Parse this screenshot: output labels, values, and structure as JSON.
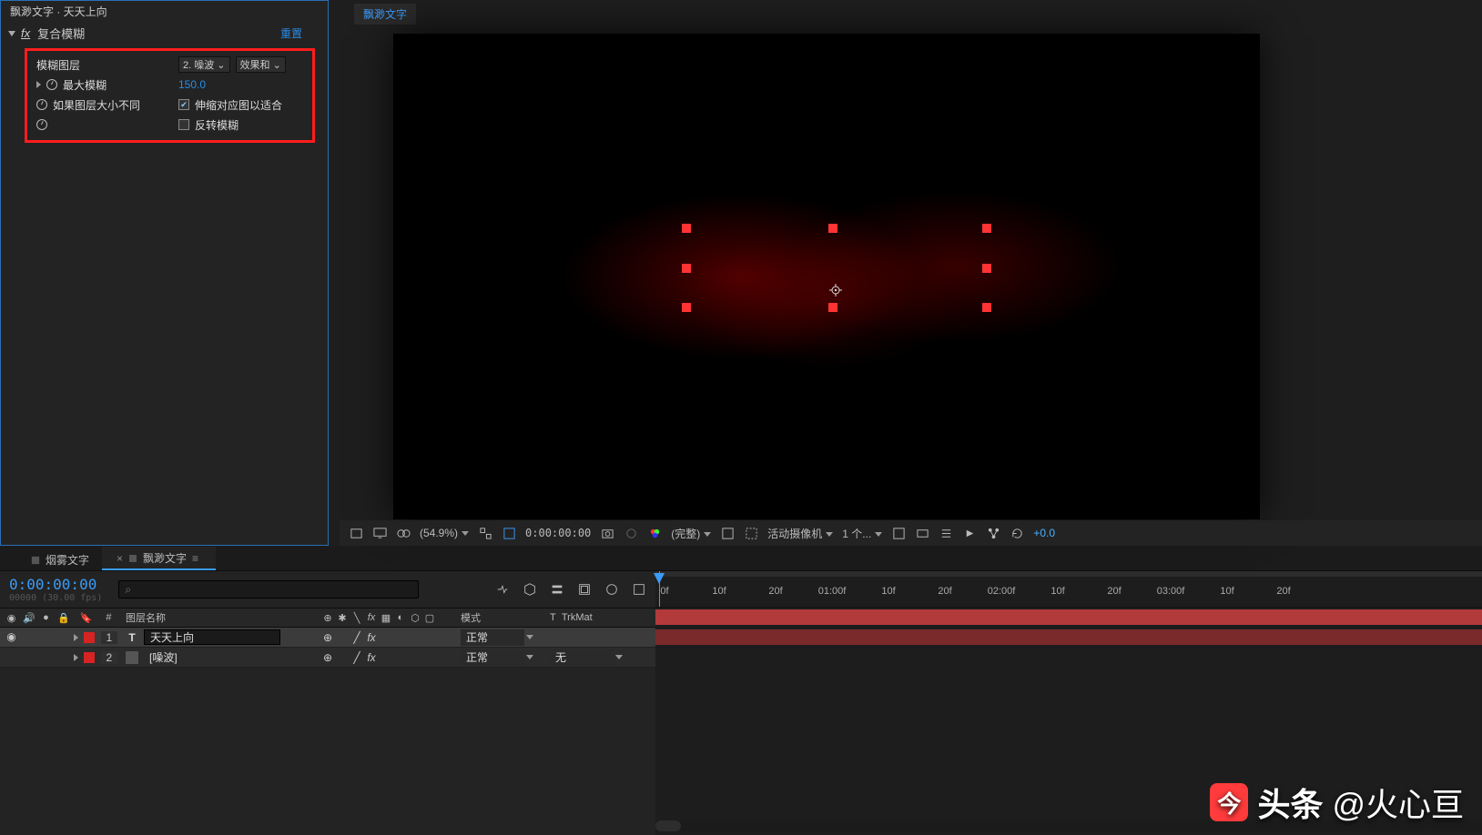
{
  "breadcrumb": "飘渺文字 · 天天上向",
  "effect": {
    "name": "复合模糊",
    "reset": "重置",
    "props": {
      "blur_layer_label": "模糊图层",
      "blur_layer_source": "2. 噪波",
      "blur_layer_scope": "效果和",
      "max_blur_label": "最大模糊",
      "max_blur_value": "150.0",
      "stretch_label": "如果图层大小不同",
      "stretch_cb_label": "伸缩对应图以适合",
      "invert_label": "反转模糊"
    }
  },
  "viewer": {
    "tab": "飘渺文字",
    "zoom": "(54.9%)",
    "time": "0:00:00:00",
    "quality": "(完整)",
    "camera": "活动摄像机",
    "views": "1 个...",
    "exposure": "+0.0"
  },
  "timeline": {
    "tabs": [
      {
        "label": "烟雾文字",
        "active": false
      },
      {
        "label": "飘渺文字",
        "active": true
      }
    ],
    "current_time": "0:00:00:00",
    "fps": "00000 (30.00 fps)",
    "search_placeholder": "ρ",
    "headers": {
      "layer_name": "图层名称",
      "mode": "模式",
      "t": "T",
      "trkmat": "TrkMat"
    },
    "layers": [
      {
        "num": "1",
        "kind": "T",
        "name": "天天上向",
        "mode": "正常",
        "trkmat": "",
        "selected": true
      },
      {
        "num": "2",
        "kind": "img",
        "name": "[噪波]",
        "mode": "正常",
        "trkmat": "无",
        "selected": false
      }
    ],
    "ruler": [
      "0f",
      "10f",
      "20f",
      "01:00f",
      "10f",
      "20f",
      "02:00f",
      "10f",
      "20f",
      "03:00f",
      "10f",
      "20f"
    ]
  },
  "watermark": {
    "brand": "头条",
    "handle": "@火心亘"
  }
}
